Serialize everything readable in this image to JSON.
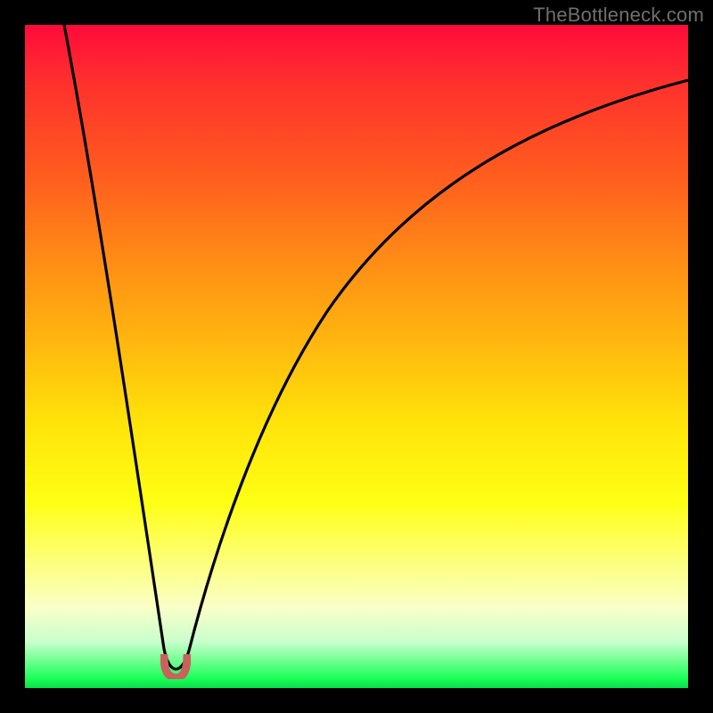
{
  "watermark": "TheBottleneck.com",
  "colors": {
    "frame": "#000000",
    "curve": "#000000",
    "marker": "#c9615d",
    "gradient_top": "#ff0a3a",
    "gradient_bottom": "#07e04a"
  },
  "chart_data": {
    "type": "line",
    "title": "",
    "xlabel": "",
    "ylabel": "",
    "xlim": [
      0,
      100
    ],
    "ylim": [
      0,
      100
    ],
    "series": [
      {
        "name": "bottleneck-curve",
        "x": [
          0,
          2,
          4,
          6,
          8,
          10,
          12,
          14,
          16,
          18,
          20,
          21,
          22,
          23,
          24,
          25,
          27,
          30,
          34,
          38,
          44,
          50,
          56,
          62,
          70,
          78,
          86,
          94,
          100
        ],
        "y": [
          100,
          92,
          84,
          76,
          68,
          59,
          51,
          42,
          33,
          23,
          12,
          6,
          2,
          1,
          2,
          6,
          16,
          29,
          42,
          52,
          63,
          71,
          77,
          82,
          87,
          90,
          93,
          95,
          96
        ]
      }
    ],
    "marker": {
      "x": 22.7,
      "y": 2,
      "label": ""
    },
    "annotations": []
  }
}
